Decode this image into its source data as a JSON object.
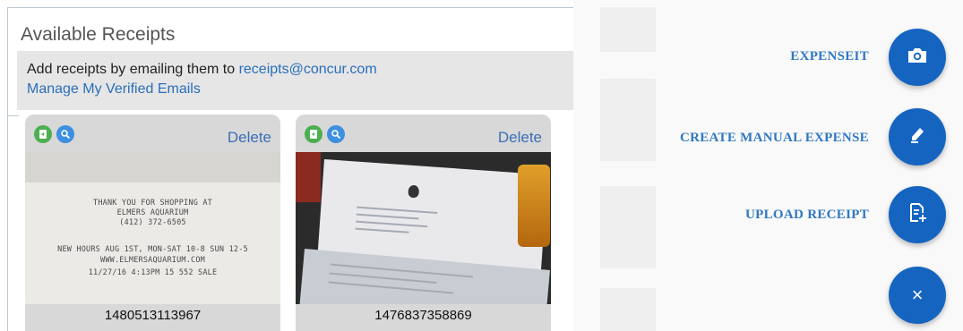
{
  "panel": {
    "title": "Available Receipts",
    "info_prefix": "Add receipts by emailing them to ",
    "info_email": "receipts@concur.com",
    "manage_link": "Manage My Verified Emails"
  },
  "receipts": [
    {
      "delete_label": "Delete",
      "id": "1480513113967",
      "image_lines": [
        "THANK YOU FOR SHOPPING AT",
        "ELMERS AQUARIUM",
        "(412) 372-6505",
        "NEW HOURS AUG 1ST, MON-SAT 10-8 SUN 12-5",
        "WWW.ELMERSAQUARIUM.COM",
        "11/27/16  4:13PM  15        552   SALE"
      ]
    },
    {
      "delete_label": "Delete",
      "id": "1476837358869"
    }
  ],
  "actions": {
    "expenseit": "EXPENSEIT",
    "create_manual": "CREATE MANUAL EXPENSE",
    "upload": "UPLOAD RECEIPT",
    "close_symbol": "×"
  },
  "icons": {
    "camera": "camera-icon",
    "pencil": "pencil-icon",
    "upload": "upload-receipt-icon",
    "close": "close-icon",
    "attach": "attach-icon",
    "zoom": "zoom-icon"
  },
  "colors": {
    "accent": "#1565c0",
    "link": "#2a6ebb",
    "attach_green": "#4caf50",
    "zoom_blue": "#3d8fe0"
  }
}
